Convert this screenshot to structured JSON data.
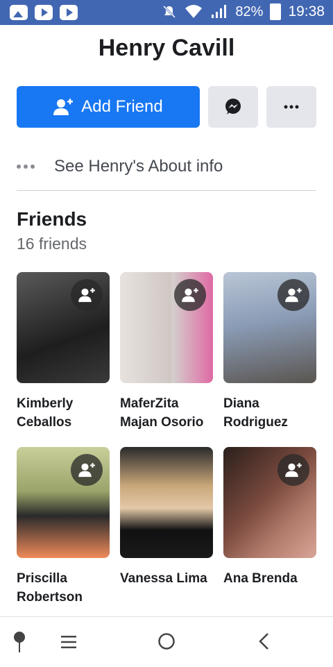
{
  "status_bar": {
    "left_icons": [
      "image-icon",
      "youtube-icon",
      "youtube-icon"
    ],
    "right_icons": [
      "mute-icon",
      "wifi-icon",
      "signal-icon",
      "battery-icon"
    ],
    "battery": "82%",
    "time": "19:38"
  },
  "profile": {
    "name": "Henry Cavill",
    "add_friend_label": "Add Friend",
    "messenger_icon": "messenger-icon",
    "more_icon": "more-icon",
    "about_label": "See Henry's About info"
  },
  "friends": {
    "title": "Friends",
    "count": "16 friends",
    "items": [
      {
        "name": "Kimberly Ceballos",
        "has_add_badge": true,
        "colors": [
          "#2b2b2b",
          "#4a4a4a"
        ]
      },
      {
        "name": "MaferZita Majan Osorio",
        "has_add_badge": true,
        "colors": [
          "#cfc7c3",
          "#d63c8f"
        ]
      },
      {
        "name": "Diana Rodriguez",
        "has_add_badge": true,
        "colors": [
          "#8a9bb5",
          "#5a5a5a"
        ]
      },
      {
        "name": "Priscilla Robertson",
        "has_add_badge": true,
        "colors": [
          "#9aa36a",
          "#f08a5a"
        ]
      },
      {
        "name": "Vanessa Lima",
        "has_add_badge": false,
        "colors": [
          "#1a1a1a",
          "#c9a77a"
        ]
      },
      {
        "name": "Ana Brenda",
        "has_add_badge": true,
        "colors": [
          "#3b2a24",
          "#b07a6a"
        ]
      }
    ]
  },
  "nav": {
    "items": [
      "pin-icon",
      "menu-icon",
      "home-circle-icon",
      "back-icon"
    ]
  },
  "colors": {
    "status_bar": "#4267b2",
    "primary": "#1877f2",
    "button_gray": "#e4e6eb"
  }
}
